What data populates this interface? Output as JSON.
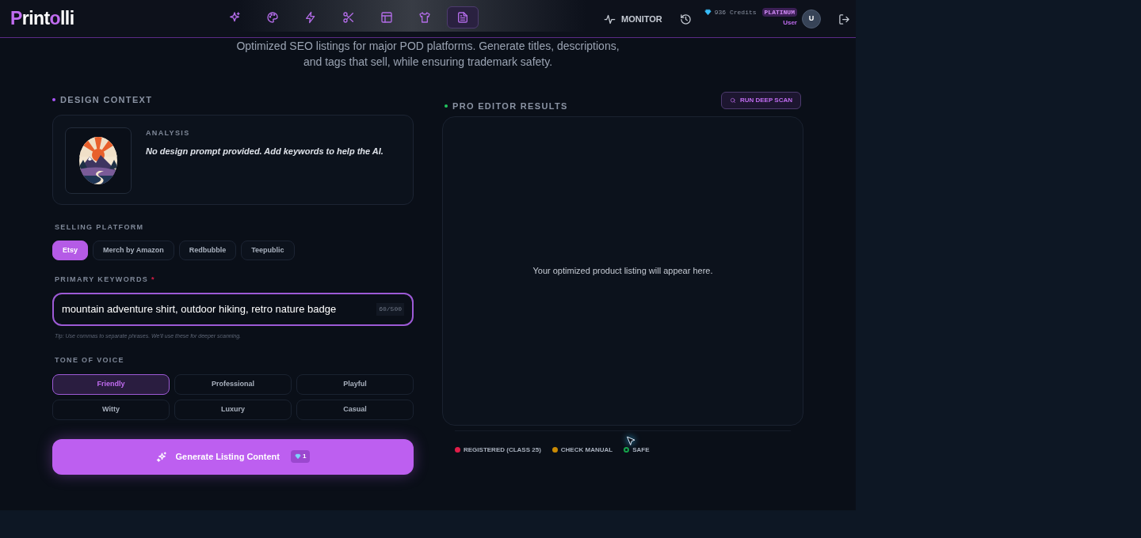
{
  "header": {
    "logo": {
      "before": "Print",
      "o": "o",
      "after": "lli"
    },
    "nav": [
      {
        "selected": false
      },
      {
        "selected": false
      },
      {
        "selected": false
      },
      {
        "selected": false
      },
      {
        "selected": false
      },
      {
        "selected": false
      },
      {
        "selected": true
      }
    ],
    "monitor": "MONITOR",
    "credits": "936 Credits",
    "plan": "PLATINUM",
    "user": "User",
    "avatar": "U"
  },
  "intro": [
    "Optimized SEO listings for major POD platforms. Generate titles, descriptions,",
    "and tags that sell, while ensuring trademark safety."
  ],
  "design_context": {
    "title": "DESIGN CONTEXT",
    "analysis_label": "ANALYSIS",
    "analysis": "No design prompt provided. Add keywords to help the AI."
  },
  "platform": {
    "label": "SELLING PLATFORM",
    "options": [
      {
        "label": "Etsy",
        "selected": true
      },
      {
        "label": "Merch by Amazon",
        "selected": false
      },
      {
        "label": "Redbubble",
        "selected": false
      },
      {
        "label": "Teepublic",
        "selected": false
      }
    ]
  },
  "keywords": {
    "label": "PRIMARY KEYWORDS",
    "required": "*",
    "value": "mountain adventure shirt, outdoor hiking, retro nature badge",
    "count": "60/500",
    "tip": "Tip: Use commas to separate phrases. We'll use these for deeper scanning."
  },
  "tone": {
    "label": "TONE OF VOICE",
    "options": [
      {
        "label": "Friendly",
        "selected": true
      },
      {
        "label": "Professional",
        "selected": false
      },
      {
        "label": "Playful",
        "selected": false
      },
      {
        "label": "Witty",
        "selected": false
      },
      {
        "label": "Luxury",
        "selected": false
      },
      {
        "label": "Casual",
        "selected": false
      }
    ]
  },
  "generate": {
    "label": "Generate Listing Content",
    "cost": "1"
  },
  "results": {
    "title": "PRO EDITOR RESULTS",
    "scan": "RUN DEEP SCAN",
    "empty": "Your optimized product listing will appear here.",
    "legend": [
      {
        "label": "REGISTERED (CLASS 25)",
        "color": "#e11d48",
        "kind": "filled"
      },
      {
        "label": "CHECK MANUAL",
        "color": "#ca8a04",
        "kind": "filled"
      },
      {
        "label": "SAFE",
        "color": "#16a34a",
        "kind": "ring"
      }
    ]
  }
}
